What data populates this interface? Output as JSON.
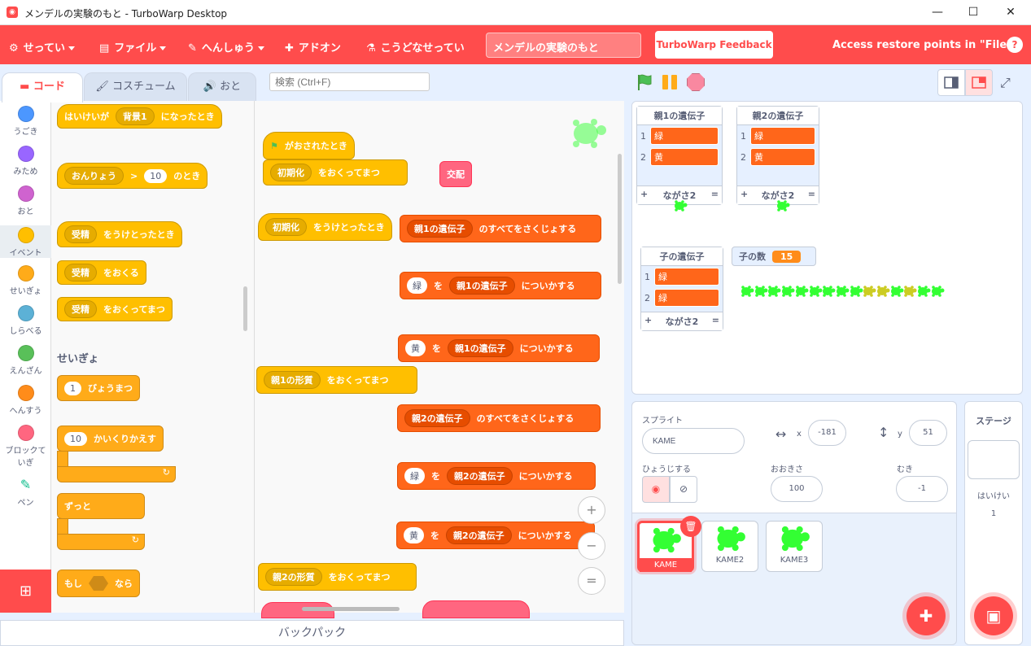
{
  "window": {
    "title": "メンデルの実験のもと - TurboWarp Desktop",
    "min": "—",
    "max": "☐",
    "close": "✕"
  },
  "menu": {
    "settings": "せってい",
    "file": "ファイル",
    "edit": "へんしゅう",
    "addons": "アドオン",
    "advanced": "こうどなせってい",
    "project_title": "メンデルの実験のもと",
    "feedback": "TurboWarp Feedback",
    "restore": "Access restore points in \"File\"",
    "help": "?"
  },
  "tabs": {
    "code": "コード",
    "costumes": "コスチューム",
    "sounds": "おと"
  },
  "search": {
    "placeholder": "検索 (Ctrl+F)"
  },
  "categories": [
    {
      "label": "うごき",
      "color": "#4c97ff"
    },
    {
      "label": "みため",
      "color": "#9966ff"
    },
    {
      "label": "おと",
      "color": "#cf63cf"
    },
    {
      "label": "イベント",
      "color": "#ffbf00"
    },
    {
      "label": "せいぎょ",
      "color": "#ffab19"
    },
    {
      "label": "しらべる",
      "color": "#5cb1d6"
    },
    {
      "label": "えんざん",
      "color": "#59c059"
    },
    {
      "label": "へんすう",
      "color": "#ff8c1a"
    },
    {
      "label": "ブロックて いぎ",
      "color": "#ff6680"
    },
    {
      "label": "ペン",
      "color": "#0fbd8c"
    }
  ],
  "palette": {
    "b1": {
      "a": "はいけいが",
      "b": "背景1",
      "c": "になったとき"
    },
    "b2": {
      "a": "おんりょう",
      "b": ">",
      "c": "10",
      "d": "のとき"
    },
    "b3": {
      "a": "受精",
      "b": "をうけとったとき"
    },
    "b4": {
      "a": "受精",
      "b": "をおくる"
    },
    "b5": {
      "a": "受精",
      "b": "をおくってまつ"
    },
    "section": "せいぎょ",
    "c1": {
      "a": "1",
      "b": "びょうまつ"
    },
    "c2": {
      "a": "10",
      "b": "かいくりかえす"
    },
    "c3": "ずっと",
    "c4": {
      "a": "もし",
      "b": "なら"
    }
  },
  "workspace": {
    "flag_hat": "がおされたとき",
    "init_send": {
      "a": "初期化",
      "b": "をおくってまつ"
    },
    "cross": "交配",
    "init_recv": {
      "a": "初期化",
      "b": "をうけとったとき"
    },
    "l1": {
      "a": "親1の遺伝子",
      "b": "のすべてをさくじょする"
    },
    "l2": {
      "a": "緑",
      "b": "を",
      "c": "親1の遺伝子",
      "d": "についかする"
    },
    "l3": {
      "a": "黄",
      "b": "を",
      "c": "親1の遺伝子",
      "d": "についかする"
    },
    "send1": {
      "a": "親1の形質",
      "b": "をおくってまつ"
    },
    "l4": {
      "a": "親2の遺伝子",
      "b": "のすべてをさくじょする"
    },
    "l5": {
      "a": "緑",
      "b": "を",
      "c": "親2の遺伝子",
      "d": "についかする"
    },
    "l6": {
      "a": "黄",
      "b": "を",
      "c": "親2の遺伝子",
      "d": "についかする"
    },
    "send2": {
      "a": "親2の形質",
      "b": "をおくってまつ"
    }
  },
  "zoom": {
    "in": "+",
    "out": "−",
    "reset": "="
  },
  "backpack": "バックパック",
  "stage": {
    "parent1": {
      "title": "親1の遺伝子",
      "items": [
        "緑",
        "黄"
      ],
      "length": "ながさ2"
    },
    "parent2": {
      "title": "親2の遺伝子",
      "items": [
        "緑",
        "黄"
      ],
      "length": "ながさ2"
    },
    "child": {
      "title": "子の遺伝子",
      "items": [
        "緑",
        "緑"
      ],
      "length": "ながさ2"
    },
    "count": {
      "label": "子の数",
      "value": "15"
    },
    "idx1": "1",
    "idx2": "2",
    "plus": "+",
    "eq": "=",
    "offspring": [
      "green",
      "green",
      "green",
      "green",
      "green",
      "green",
      "green",
      "green",
      "green",
      "yellow",
      "yellow",
      "green",
      "yellow",
      "green",
      "green"
    ],
    "colors": {
      "green": "#33ff33",
      "yellow": "#cccc22"
    }
  },
  "sprite": {
    "label": "スプライト",
    "name": "KAME",
    "x_label": "x",
    "x": "-181",
    "y_label": "y",
    "y": "51",
    "show_label": "ひょうじする",
    "size_label": "おおきさ",
    "size": "100",
    "dir_label": "むき",
    "dir": "-1",
    "tiles": [
      "KAME",
      "KAME2",
      "KAME3"
    ]
  },
  "stagepane": {
    "title": "ステージ",
    "backdrops_label": "はいけい",
    "backdrops": "1"
  }
}
